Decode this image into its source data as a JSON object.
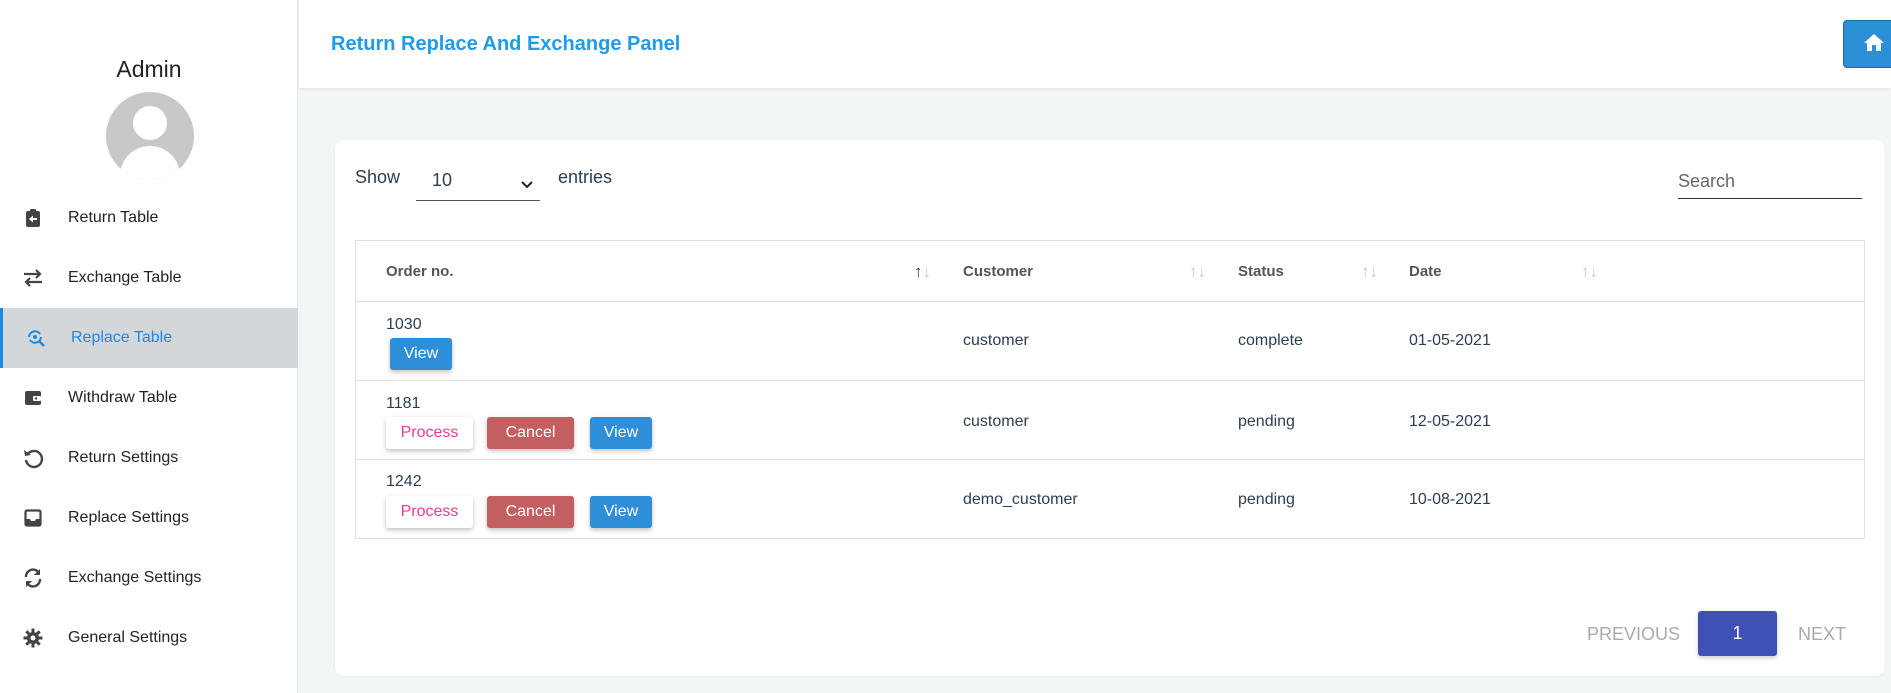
{
  "sidebar": {
    "admin_name": "Admin",
    "items": [
      {
        "label": "Return Table",
        "icon": "clipboard-return-icon"
      },
      {
        "label": "Exchange Table",
        "icon": "swap-arrows-icon"
      },
      {
        "label": "Replace Table",
        "icon": "replace-search-icon",
        "active": true
      },
      {
        "label": "Withdraw Table",
        "icon": "wallet-icon"
      },
      {
        "label": "Return Settings",
        "icon": "undo-icon"
      },
      {
        "label": "Replace Settings",
        "icon": "inbox-icon"
      },
      {
        "label": "Exchange Settings",
        "icon": "refresh-icon"
      },
      {
        "label": "General Settings",
        "icon": "gear-icon"
      }
    ]
  },
  "header": {
    "title": "Return Replace And Exchange Panel",
    "home_icon": "home-icon"
  },
  "controls": {
    "show_label": "Show",
    "entries_value": "10",
    "entries_label": "entries",
    "search_placeholder": "Search"
  },
  "table": {
    "columns": [
      "Order no.",
      "Customer",
      "Status",
      "Date"
    ],
    "rows": [
      {
        "order_no": "1030",
        "customer": "customer",
        "status": "complete",
        "date": "01-05-2021",
        "actions": [
          "View"
        ]
      },
      {
        "order_no": "1181",
        "customer": "customer",
        "status": "pending",
        "date": "12-05-2021",
        "actions": [
          "Process",
          "Cancel",
          "View"
        ]
      },
      {
        "order_no": "1242",
        "customer": "demo_customer",
        "status": "pending",
        "date": "10-08-2021",
        "actions": [
          "Process",
          "Cancel",
          "View"
        ]
      }
    ]
  },
  "pagination": {
    "previous": "PREVIOUS",
    "current": "1",
    "next": "NEXT"
  },
  "colors": {
    "accent": "#1e9be9",
    "active_nav_bg": "#d3d7d9",
    "view_button": "#2f8ed8",
    "cancel_button": "#c35f61",
    "process_text": "#e83e8c",
    "page_button": "#3f51b5"
  }
}
